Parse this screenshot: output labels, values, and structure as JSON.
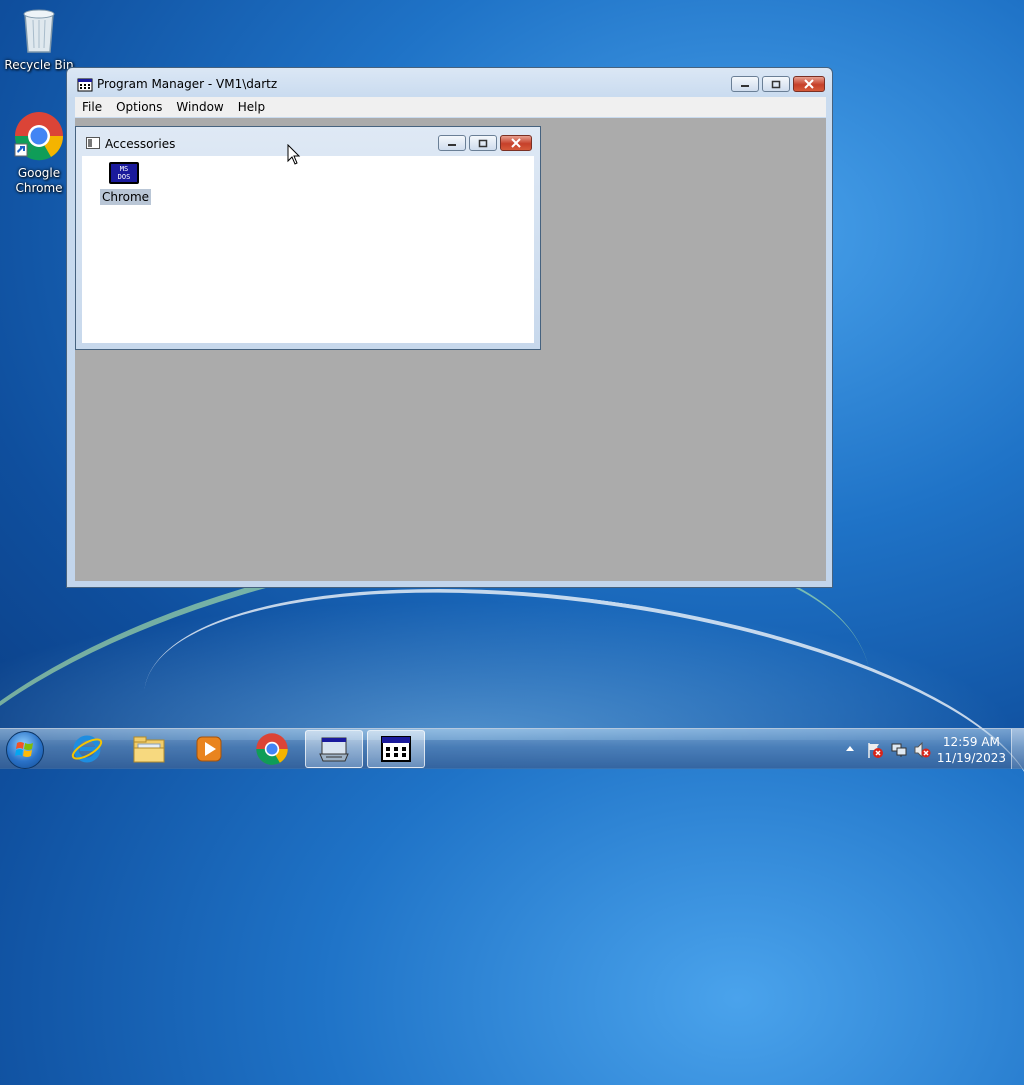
{
  "desktop": {
    "icons": [
      {
        "label": "Recycle Bin"
      },
      {
        "label_line1": "Google",
        "label_line2": "Chrome"
      }
    ]
  },
  "program_manager": {
    "title": "Program Manager - VM1\\dartz",
    "menu": [
      "File",
      "Options",
      "Window",
      "Help"
    ],
    "child_window": {
      "title": "Accessories",
      "program_icon": {
        "icon": "ms-dos-icon",
        "icon_text_1": "MS",
        "icon_text_2": "DOS",
        "label": "Chrome"
      }
    }
  },
  "taskbar": {
    "pinned": [
      "internet-explorer-icon",
      "windows-explorer-icon",
      "media-player-icon",
      "chrome-icon",
      "program-icon",
      "program-manager-icon"
    ],
    "clock": {
      "time": "12:59 AM",
      "date": "11/19/2023"
    }
  },
  "colors": {
    "mdi_background": "#ababab",
    "selection": "#b9c6d6"
  }
}
